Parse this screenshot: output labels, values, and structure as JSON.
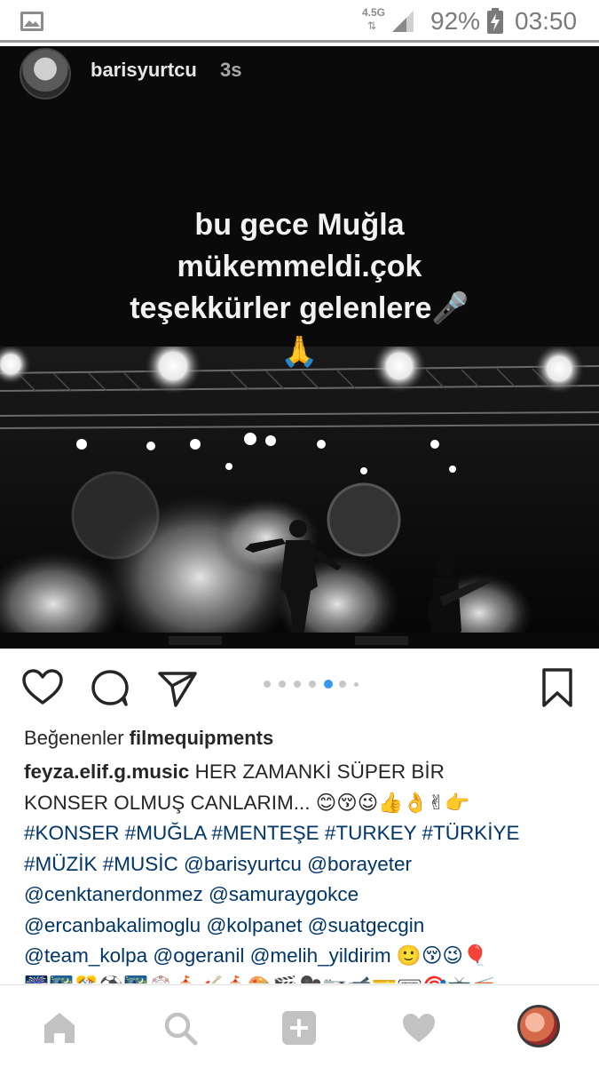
{
  "status_bar": {
    "network": "4.5G",
    "arrows": "⇅",
    "battery_percent": "92%",
    "time": "03:50",
    "icons": [
      "gallery-icon",
      "signal-icon",
      "battery-charging-icon"
    ]
  },
  "post": {
    "username": "barisyurtcu",
    "time_ago": "3s",
    "story_lines": [
      "bu gece Muğla",
      "mükemmeldi.çok",
      "teşekkürler gelenlere🎤",
      "🙏"
    ],
    "carousel": {
      "dot_count": 7,
      "active_index": 4
    },
    "likes_prefix": "Beğenenler",
    "liked_by": "filmequipments",
    "caption_user": "feyza.elif.g.music",
    "caption_lines": [
      " HER ZAMANKİ SÜPER BİR",
      "KONSER OLMUŞ CANLARIM... 😊😚😉👍👌✌👉",
      "#KONSER #MUĞLA #MENTEŞE #TURKEY #TÜRKİYE",
      "#MÜZİK #MUSİC  @barisyurtcu @borayeter",
      "@cenktanerdonmez @samuraygokce",
      "@ercanbakalimoglu @kolpanet @suatgecgin",
      "@team_kolpa @ogeranil @melih_yildirim 🙂😚😉🎈",
      "🎆🌃🎊⚽🌃🎡🎪🎸🎪🎨🎬🎥📷📹🎫🎟🎯📺📻"
    ]
  },
  "icons": {
    "actions": [
      "heart-icon",
      "comment-icon",
      "share-icon",
      "bookmark-icon"
    ],
    "nav": [
      "home-icon",
      "search-icon",
      "add-post-icon",
      "activity-heart-icon",
      "profile-avatar"
    ]
  },
  "colors": {
    "hashtag": "#003569",
    "text": "#262626",
    "dot_active": "#3897f0",
    "dot_inactive": "#c7c7c7"
  }
}
